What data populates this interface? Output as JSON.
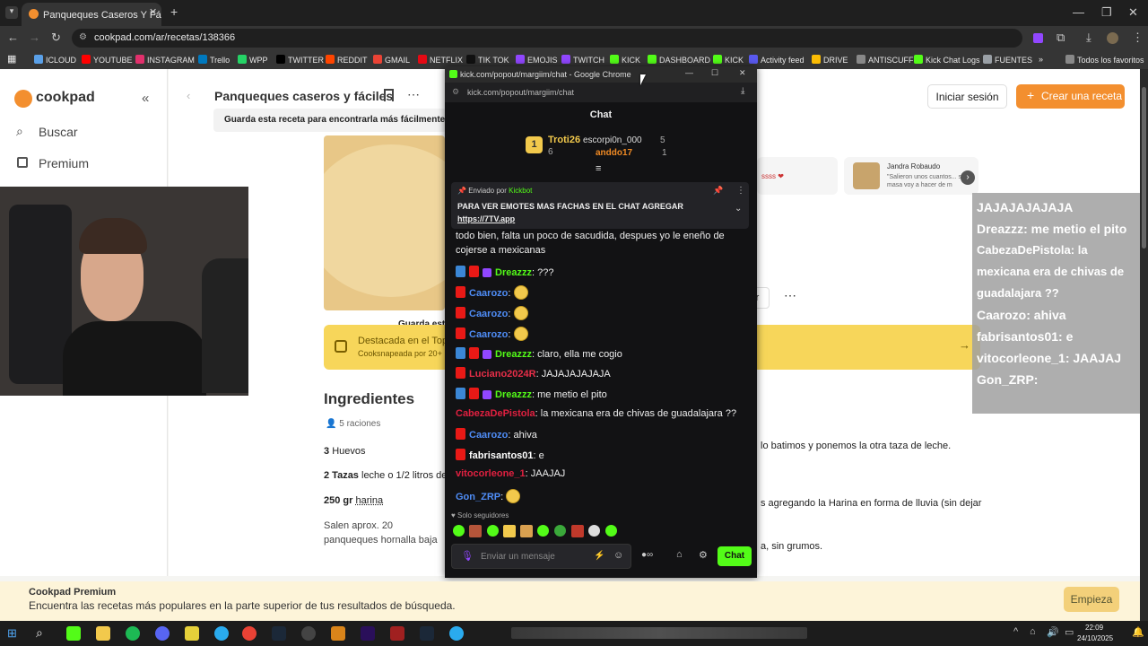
{
  "browser": {
    "tab_title": "Panqueques Caseros Y Fáciles R",
    "url": "cookpad.com/ar/recetas/138366",
    "bookmarks": [
      {
        "label": "ICLOUD",
        "color": "#5aa0e8"
      },
      {
        "label": "YOUTUBE",
        "color": "#ff0000"
      },
      {
        "label": "INSTAGRAM",
        "color": "#e1306c"
      },
      {
        "label": "Trello",
        "color": "#0079bf"
      },
      {
        "label": "WPP",
        "color": "#25d366"
      },
      {
        "label": "TWITTER",
        "color": "#000000"
      },
      {
        "label": "REDDIT",
        "color": "#ff4500"
      },
      {
        "label": "GMAIL",
        "color": "#ea4335"
      },
      {
        "label": "NETFLIX",
        "color": "#e50914"
      },
      {
        "label": "TIK TOK",
        "color": "#111111"
      },
      {
        "label": "EMOJIS",
        "color": "#9147ff"
      },
      {
        "label": "TWITCH",
        "color": "#9147ff"
      },
      {
        "label": "KICK",
        "color": "#53fc18"
      },
      {
        "label": "DASHBOARD",
        "color": "#53fc18"
      },
      {
        "label": "KICK",
        "color": "#53fc18"
      },
      {
        "label": "Activity feed",
        "color": "#5a5af0"
      },
      {
        "label": "DRIVE",
        "color": "#fbbc04"
      },
      {
        "label": "ANTISCUFF",
        "color": "#888888"
      },
      {
        "label": "Kick Chat Logs",
        "color": "#53fc18"
      },
      {
        "label": "FUENTES",
        "color": "#9aa0a6"
      }
    ],
    "more_bookmarks": "»",
    "all_favorites": "Todos los favoritos"
  },
  "cookpad": {
    "logo": "cookpad",
    "nav_search": "Buscar",
    "nav_premium": "Premium",
    "recipe_title": "Panqueques caseros y fáciles",
    "save_tooltip": "Guarda esta receta para encontrarla más fácilmente cua",
    "login": "Iniciar sesión",
    "create": "Crear una receta",
    "comment_author": "Jandra Robaudo",
    "comment_text": "\"Salieron unos cuantos... sobró masa voy a hacer de m",
    "comment_snippet": "ssss",
    "save_short": "Guarda esta",
    "featured_title": "Destacada en el Top",
    "featured_sub": "Cooksnapeada por 20+",
    "ingredients_title": "Ingredientes",
    "servings": "5 raciones",
    "ingredients": [
      {
        "qty": "3",
        "name": "Huevos"
      },
      {
        "qty": "2 Tazas",
        "name": "leche o 1/2 litros de l"
      },
      {
        "qty": "250 gr",
        "name": "harina"
      }
    ],
    "note": "Salen aprox. 20 panqueques hornalla baja",
    "step1": "lo batimos y ponemos la otra taza de leche.",
    "step2": "s agregando la Harina en forma de lluvia (sin dejar",
    "step3": "a, sin grumos.",
    "partial_btn": "mir"
  },
  "popout": {
    "window_title": "kick.com/popout/margiim/chat - Google Chrome",
    "url": "kick.com/popout/margiim/chat",
    "chat_title": "Chat",
    "leaderboard": [
      {
        "name": "Troti26",
        "count": "6"
      },
      {
        "name": "escorpi0n_000",
        "count": "5"
      },
      {
        "name": "anddo17",
        "count": "1"
      }
    ],
    "pinned_by_label": "Enviado por",
    "pinned_by_user": "Kickbot",
    "pinned_text": "PARA VER EMOTES MAS FACHAS EN EL CHAT AGREGAR",
    "pinned_link": "https://7TV.app",
    "msg_intro": "todo bien, falta un poco de sacudida, despues yo le eneño de",
    "msg_intro2": "cojerse a mexicanas",
    "messages": [
      {
        "user": "Dreazzz",
        "text": "???"
      },
      {
        "user": "Caarozo",
        "text": ""
      },
      {
        "user": "Caarozo",
        "text": ""
      },
      {
        "user": "Caarozo",
        "text": ""
      },
      {
        "user": "Dreazzz",
        "text": "claro, ella me cogio"
      },
      {
        "user": "Luciano2024R",
        "text": "JAJAJAJAJAJA"
      },
      {
        "user": "Dreazzz",
        "text": "me metio el pito"
      },
      {
        "user": "CabezaDePistola",
        "text": "la mexicana era de chivas de guadalajara ??"
      },
      {
        "user": "Caarozo",
        "text": "ahiva"
      },
      {
        "user": "fabrisantos01",
        "text": "e"
      },
      {
        "user": "vitocorleone_1",
        "text": "JAAJAJ"
      },
      {
        "user": "Gon_ZRP",
        "text": ""
      }
    ],
    "followers_only": "Solo seguidores",
    "input_placeholder": "Enviar un mensaje",
    "send": "Chat"
  },
  "overlay_chat": {
    "lines": [
      "JAJAJAJAJAJA",
      "Dreazzz: me metio el pito",
      "CabezaDePistola: la mexicana era de chivas de guadalajara ??",
      "Caarozo: ahiva",
      "fabrisantos01: e",
      "vitocorleone_1: JAAJAJ",
      "Gon_ZRP:"
    ]
  },
  "premium_banner": {
    "title": "Cookpad Premium",
    "text": "Encuentra las recetas más populares en la parte superior de tus resultados de búsqueda.",
    "button": "Empieza"
  },
  "taskbar": {
    "time": "22:09",
    "date": "24/10/2025"
  }
}
